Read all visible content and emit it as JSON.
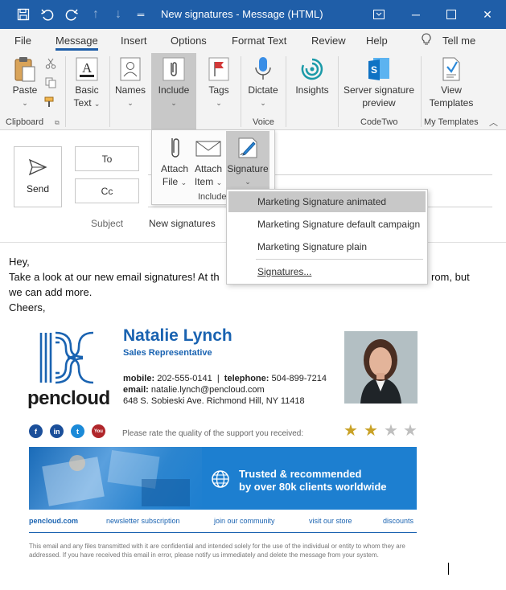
{
  "window": {
    "title": "New signatures  -  Message (HTML)",
    "controls": [
      "minimize-icon",
      "maximize-icon",
      "close-icon"
    ]
  },
  "quick_access": [
    "save-icon",
    "undo-icon",
    "redo-icon",
    "up-icon",
    "down-icon",
    "customize-icon"
  ],
  "tabs": [
    {
      "label": "File"
    },
    {
      "label": "Message"
    },
    {
      "label": "Insert"
    },
    {
      "label": "Options"
    },
    {
      "label": "Format Text"
    },
    {
      "label": "Review"
    },
    {
      "label": "Help"
    },
    {
      "label": "Tell me"
    }
  ],
  "ribbon": {
    "paste": "Paste",
    "basic_text_1": "Basic",
    "basic_text_2": "Text",
    "names": "Names",
    "include": "Include",
    "tags": "Tags",
    "dictate": "Dictate",
    "insights": "Insights",
    "server_sig_1": "Server signature",
    "server_sig_2": "preview",
    "view_templates_1": "View",
    "view_templates_2": "Templates",
    "groups": {
      "clipboard": "Clipboard",
      "voice": "Voice",
      "codetwo": "CodeTwo",
      "my_templates": "My Templates"
    }
  },
  "include_panel": {
    "attach_file_1": "Attach",
    "attach_file_2": "File",
    "attach_item_1": "Attach",
    "attach_item_2": "Item",
    "signature": "Signature",
    "group_label": "Include"
  },
  "compose": {
    "send": "Send",
    "to": "To",
    "cc": "Cc",
    "subject_label": "Subject",
    "subject_value": "New signatures"
  },
  "signature_menu": {
    "items": [
      "Marketing Signature animated",
      "Marketing Signature default campaign",
      "Marketing Signature plain"
    ],
    "manage": "Signatures..."
  },
  "body": {
    "line1": "Hey,",
    "line2_a": "Take a look at our new email signatures! At th",
    "line2_b": "rom, but",
    "line3": "we can add more.",
    "line4": "Cheers,"
  },
  "signature": {
    "name": "Natalie Lynch",
    "role": "Sales Representative",
    "mobile_label": "mobile:",
    "mobile": "202-555-0141",
    "telephone_label": "telephone:",
    "telephone": "504-899-7214",
    "email_label": "email:",
    "email": "natalie.lynch@pencloud.com",
    "address": "648 S. Sobieski Ave. Richmond Hill, NY 11418",
    "brand": "pencloud",
    "rate_text": "Please rate the quality of the support you received:",
    "rating": 2,
    "rating_max": 4,
    "banner_line1": "Trusted & recommended",
    "banner_line2": "by over 80k clients worldwide",
    "links": [
      "pencloud.com",
      "newsletter subscription",
      "join our community",
      "visit our store",
      "discounts"
    ],
    "disclaimer": "This email and any files transmitted with it are confidential and intended solely for the use of the individual or entity to whom they are addressed. If you have received this email in error, please notify us immediately and delete the message from your system.",
    "social": [
      "facebook-icon",
      "linkedin-icon",
      "twitter-icon",
      "youtube-icon"
    ],
    "colors": {
      "brand_blue": "#1a63b1",
      "star": "#c9a227",
      "star_empty": "#bfbfbf"
    }
  }
}
